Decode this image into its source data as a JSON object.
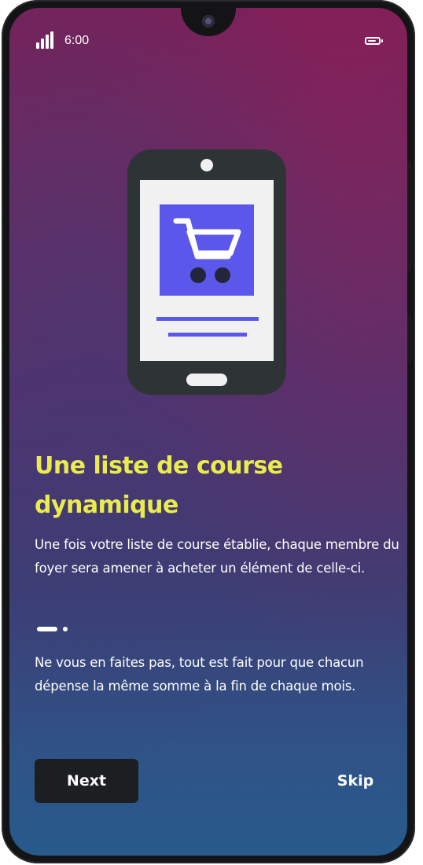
{
  "status_bar": {
    "time": "6:00",
    "icons": [
      "signal-icon",
      "battery-icon"
    ]
  },
  "illustration": {
    "icon": "shopping-cart-icon",
    "colors": {
      "phone_body": "#2e3436",
      "screen": "#f1f1f1",
      "card": "#5b57ea",
      "cart": "#ffffff",
      "wheels": "#23263a"
    }
  },
  "onboarding": {
    "title": "Une liste de course dynamique",
    "description_1": "Une fois votre liste de course établie, chaque membre du foyer sera amener à acheter un élément de celle-ci.",
    "description_2": "Ne vous en faites pas, tout est fait pour que chacun dépense la même somme à la fin de chaque mois.",
    "pager": {
      "current_page": 1,
      "total_pages": 2
    }
  },
  "actions": {
    "next_label": "Next",
    "skip_label": "Skip"
  },
  "colors": {
    "title": "#e9ec4c",
    "text": "#ffffff",
    "button_bg": "#1d1e22",
    "background_top": "#7c1f57",
    "background_bottom": "#285a8c"
  }
}
